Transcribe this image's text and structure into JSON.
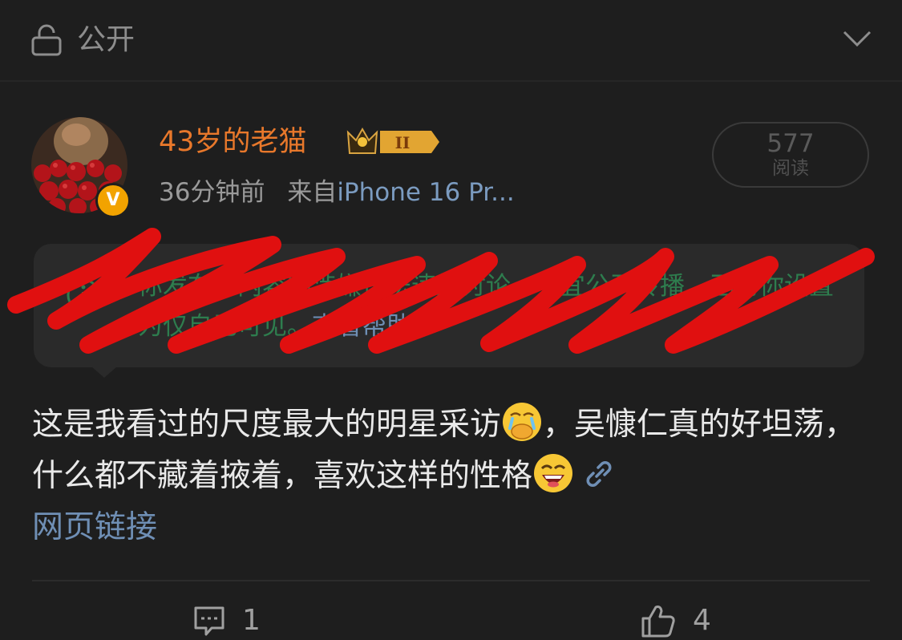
{
  "header": {
    "visibility_label": "公开"
  },
  "post": {
    "author": {
      "name": "43岁的老猫",
      "level_badge": "II"
    },
    "time": "36分钟前",
    "source_prefix": "来自",
    "device": "iPhone 16 Pr...",
    "reads": {
      "count": "577",
      "label": "阅读"
    },
    "notice": {
      "text": "你发布的内容因涉嫌违法违规讨论，不宜公开传播，已为你设置为仅自己可见。",
      "help_link": "查看帮助"
    },
    "content": {
      "part1": "这是我看过的尺度最大的明星采访",
      "part2": "，吴慷仁真的好坦荡，什么都不藏着掖着，喜欢这样的性格",
      "link_label": "网页链接"
    },
    "actions": {
      "comment_count": "1",
      "like_count": "4"
    }
  },
  "colors": {
    "username": "#e8782b",
    "link": "#6f8fb5",
    "verified_badge": "#f2a300",
    "scribble": "#e01010"
  }
}
